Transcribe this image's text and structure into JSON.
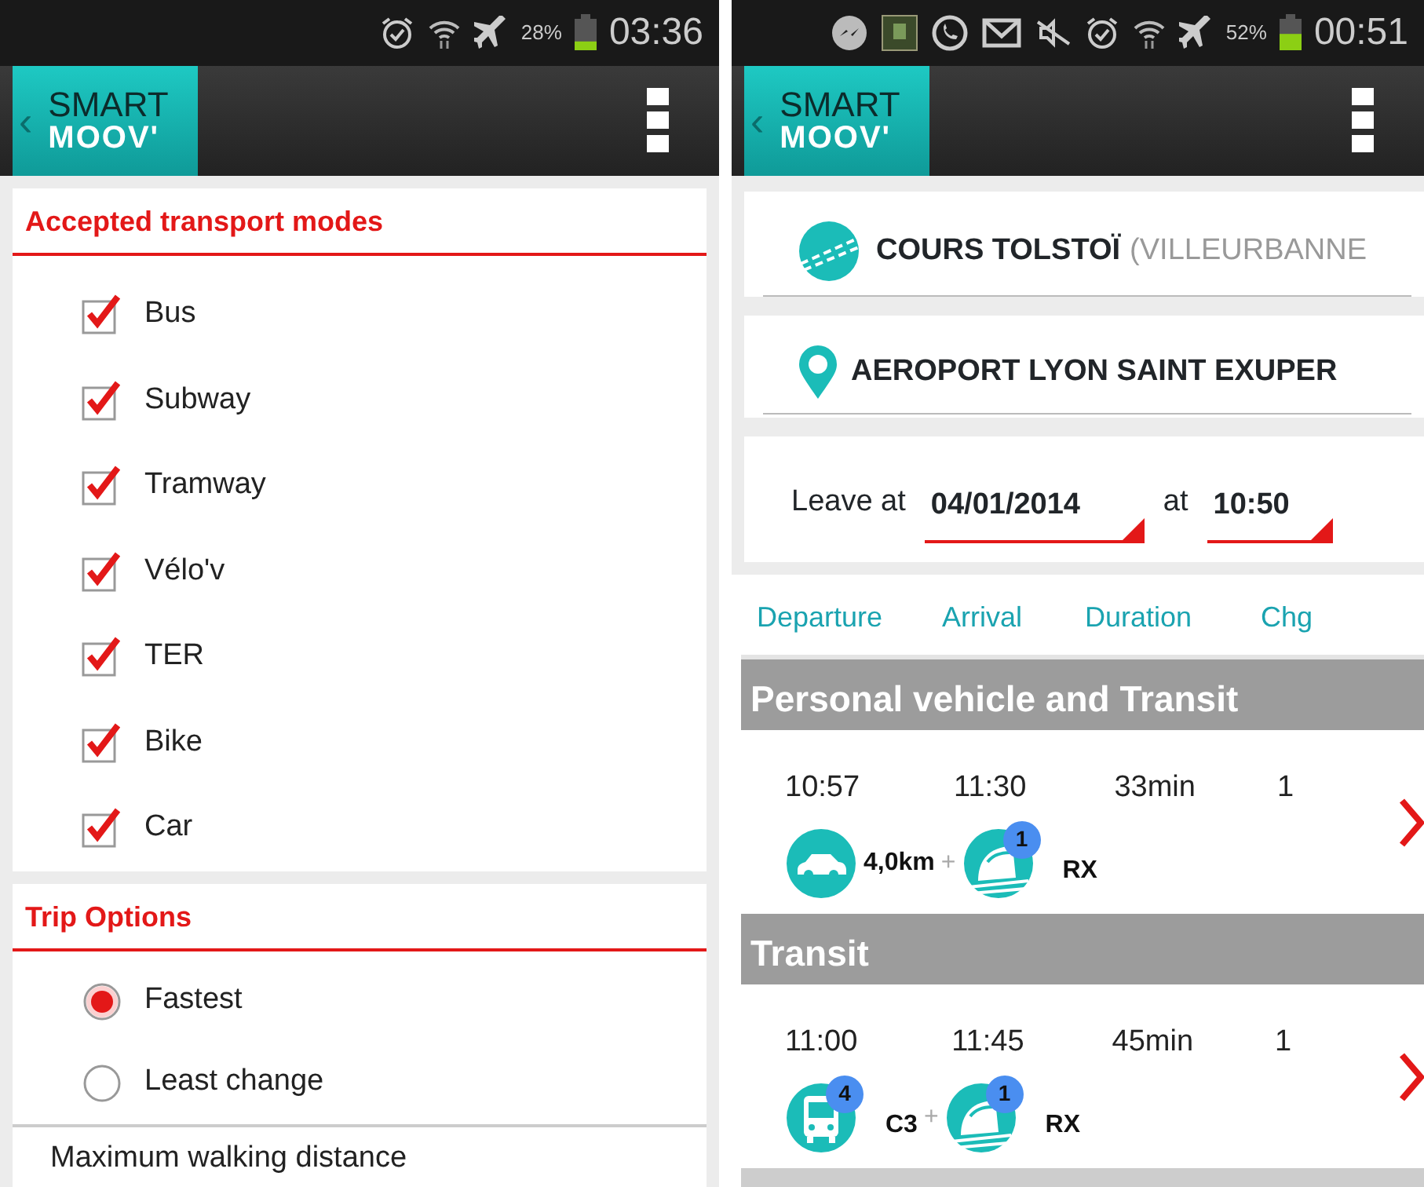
{
  "left_screen": {
    "status_bar": {
      "icons": [
        {
          "kind": "alarm"
        },
        {
          "kind": "wifi"
        },
        {
          "kind": "airplane"
        }
      ],
      "battery": "28%",
      "time": "03:36"
    },
    "app_bar": {
      "back": "‹",
      "logo_top": "SMART",
      "logo_bottom": "MOOV'"
    },
    "sections": [
      {
        "title": "Accepted transport modes",
        "kind": "checkbox",
        "items": [
          {
            "label": "Bus",
            "checked": true
          },
          {
            "label": "Subway",
            "checked": true
          },
          {
            "label": "Tramway",
            "checked": true
          },
          {
            "label": "Vélo'v",
            "checked": true
          },
          {
            "label": "TER",
            "checked": true
          },
          {
            "label": "Bike",
            "checked": true
          },
          {
            "label": "Car",
            "checked": true
          }
        ]
      },
      {
        "title": "Trip Options",
        "kind": "radio",
        "items": [
          {
            "label": "Fastest",
            "selected": true
          },
          {
            "label": "Least change",
            "selected": false
          }
        ],
        "footer": "Maximum walking distance"
      }
    ]
  },
  "right_screen": {
    "status_bar": {
      "icons": [
        {
          "kind": "messenger"
        },
        {
          "kind": "app"
        },
        {
          "kind": "whatsapp"
        },
        {
          "kind": "mail"
        },
        {
          "kind": "mute"
        },
        {
          "kind": "alarm"
        },
        {
          "kind": "wifi"
        },
        {
          "kind": "airplane"
        }
      ],
      "battery": "52%",
      "time": "00:51"
    },
    "app_bar": {
      "back": "‹",
      "logo_top": "SMART",
      "logo_bottom": "MOOV'"
    },
    "origin": {
      "name": "COURS TOLSTOÏ",
      "detail": "(VILLEURBANNE"
    },
    "destination": {
      "name": "AEROPORT LYON SAINT EXUPER"
    },
    "schedule": {
      "leave_label": "Leave at",
      "date": "04/01/2014",
      "at_label": "at",
      "time": "10:50"
    },
    "columns": [
      "Departure",
      "Arrival",
      "Duration",
      "Chg"
    ],
    "groups": [
      {
        "title": "Personal vehicle and Transit",
        "trips": [
          {
            "departure": "10:57",
            "arrival": "11:30",
            "duration": "33min",
            "changes": "1",
            "legs": [
              {
                "kind": "car",
                "label": "4,0km"
              },
              {
                "kind": "separator",
                "label": "+"
              },
              {
                "kind": "train",
                "badge": "1",
                "label": "RX"
              }
            ]
          }
        ]
      },
      {
        "title": "Transit",
        "trips": [
          {
            "departure": "11:00",
            "arrival": "11:45",
            "duration": "45min",
            "changes": "1",
            "legs": [
              {
                "kind": "bus",
                "badge": "4",
                "label": "C3"
              },
              {
                "kind": "separator",
                "label": "+"
              },
              {
                "kind": "train",
                "badge": "1",
                "label": "RX"
              }
            ]
          }
        ]
      }
    ]
  }
}
